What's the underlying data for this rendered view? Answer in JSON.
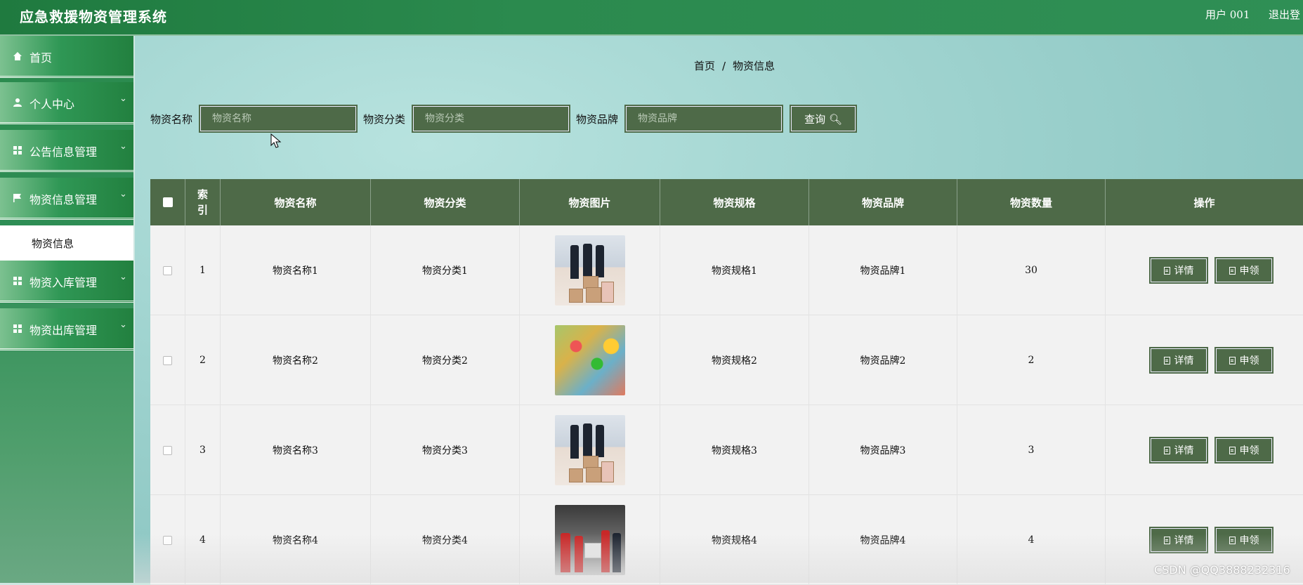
{
  "header": {
    "title": "应急救援物资管理系统",
    "user_label": "用户 001",
    "logout_label": "退出登"
  },
  "sidebar": {
    "items": [
      {
        "label": "首页",
        "icon": "home-icon"
      },
      {
        "label": "个人中心",
        "icon": "person-icon"
      },
      {
        "label": "公告信息管理",
        "icon": "grid-icon"
      },
      {
        "label": "物资信息管理",
        "icon": "flag-icon"
      },
      {
        "label": "物资信息",
        "icon": ""
      },
      {
        "label": "物资入库管理",
        "icon": "grid-icon"
      },
      {
        "label": "物资出库管理",
        "icon": "grid-icon"
      }
    ]
  },
  "breadcrumb": {
    "home": "首页",
    "sep": "/",
    "current": "物资信息"
  },
  "search": {
    "name_label": "物资名称",
    "name_placeholder": "物资名称",
    "category_label": "物资分类",
    "category_placeholder": "物资分类",
    "brand_label": "物资品牌",
    "brand_placeholder": "物资品牌",
    "button_label": "查询"
  },
  "table": {
    "headers": {
      "index": "索引",
      "name": "物资名称",
      "category": "物资分类",
      "image": "物资图片",
      "spec": "物资规格",
      "brand": "物资品牌",
      "quantity": "物资数量",
      "action": "操作"
    },
    "rows": [
      {
        "index": "1",
        "name": "物资名称1",
        "category": "物资分类1",
        "image": "warehouse-photo",
        "spec": "物资规格1",
        "brand": "物资品牌1",
        "quantity": "30"
      },
      {
        "index": "2",
        "name": "物资名称2",
        "category": "物资分类2",
        "image": "food-supplies-photo",
        "spec": "物资规格2",
        "brand": "物资品牌2",
        "quantity": "2"
      },
      {
        "index": "3",
        "name": "物资名称3",
        "category": "物资分类3",
        "image": "warehouse-photo",
        "spec": "物资规格3",
        "brand": "物资品牌3",
        "quantity": "3"
      },
      {
        "index": "4",
        "name": "物资名称4",
        "category": "物资分类4",
        "image": "volunteers-photo",
        "spec": "物资规格4",
        "brand": "物资品牌4",
        "quantity": "4"
      }
    ],
    "detail_label": "详情",
    "apply_label": "申领"
  },
  "watermark": "CSDN @QQ3888232316",
  "colors": {
    "header": "#2b8a4e",
    "sidebar": "#2f9755",
    "table_header": "#4e6a48",
    "button": "#4e6a48"
  }
}
